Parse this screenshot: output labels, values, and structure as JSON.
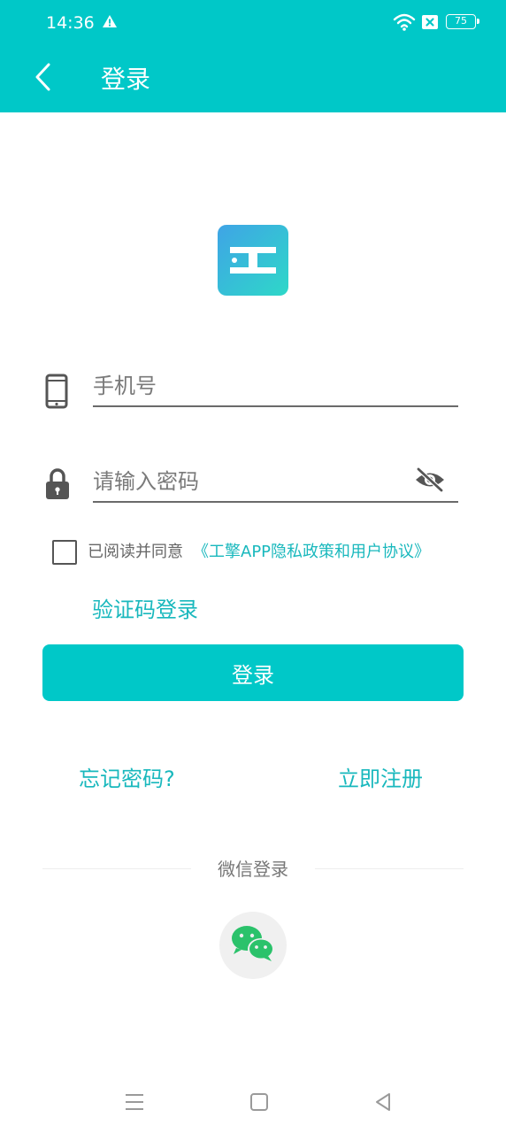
{
  "status_bar": {
    "time": "14:36",
    "battery": "75",
    "icons": [
      "warning-icon",
      "wifi-icon",
      "sim-disabled-icon",
      "battery-icon"
    ]
  },
  "header": {
    "title": "登录",
    "back_icon": "back-arrow-icon"
  },
  "logo": {
    "icon": "app-logo-icon"
  },
  "form": {
    "phone_placeholder": "手机号",
    "phone_icon": "phone-icon",
    "password_placeholder": "请输入密码",
    "password_icon": "lock-icon",
    "visibility_icon": "eye-hidden-icon"
  },
  "agreement": {
    "prefix": "已阅读并同意",
    "link": "《工擎APP隐私政策和用户协议》"
  },
  "actions": {
    "sms_login": "验证码登录",
    "login_button": "登录",
    "forgot_password": "忘记密码?",
    "register": "立即注册"
  },
  "third_party": {
    "label": "微信登录",
    "wechat_icon": "wechat-icon"
  },
  "navigation_bar": {
    "icons": [
      "menu-icon",
      "home-icon",
      "back-icon"
    ]
  },
  "colors": {
    "accent": "#00C8C8",
    "link": "#19B8BD",
    "wechat_green": "#2BC26B"
  }
}
